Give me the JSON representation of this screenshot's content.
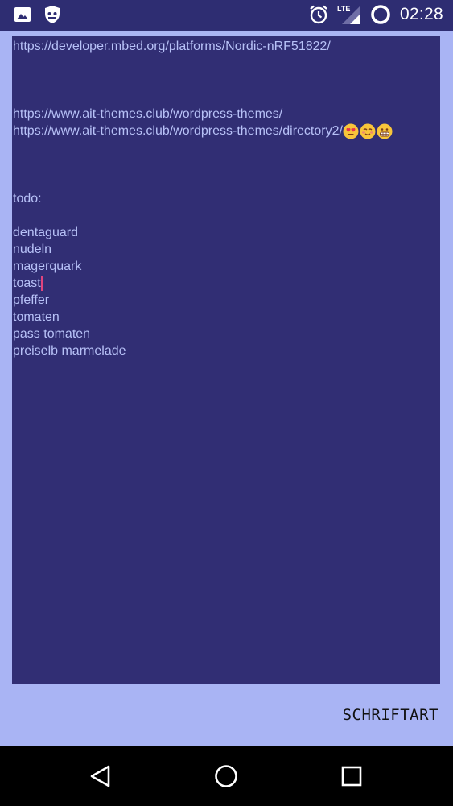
{
  "status_bar": {
    "time": "02:28",
    "network_label": "LTE",
    "icons": [
      "gallery-icon",
      "guardian-app-icon",
      "alarm-icon",
      "signal-icon",
      "battery-icon"
    ]
  },
  "editor": {
    "lines": [
      "https://developer.mbed.org/platforms/Nordic-nRF51822/",
      "",
      "",
      "",
      "https://www.ait-themes.club/wordpress-themes/",
      "https://www.ait-themes.club/wordpress-themes/directory2/",
      "",
      "",
      "",
      "todo:",
      "",
      "dentaguard",
      "nudeln",
      "magerquark",
      "toast",
      "pfeffer",
      "tomaten",
      "pass tomaten",
      "preiselb marmelade"
    ],
    "emojis_after_line": 5,
    "emojis": [
      "heart-eyes-emoji",
      "blush-emoji",
      "grimace-emoji"
    ],
    "cursor_line": 14
  },
  "font_button": {
    "label": "SCHRIFTART"
  },
  "nav": {
    "back": "back-icon",
    "home": "home-icon",
    "recents": "recents-icon"
  },
  "colors": {
    "status_bar_bg": "#2e2d72",
    "editor_bg": "#312e74",
    "editor_text": "#b7c1f7",
    "page_bg": "#a9b4f4",
    "cursor": "#e0447e"
  }
}
